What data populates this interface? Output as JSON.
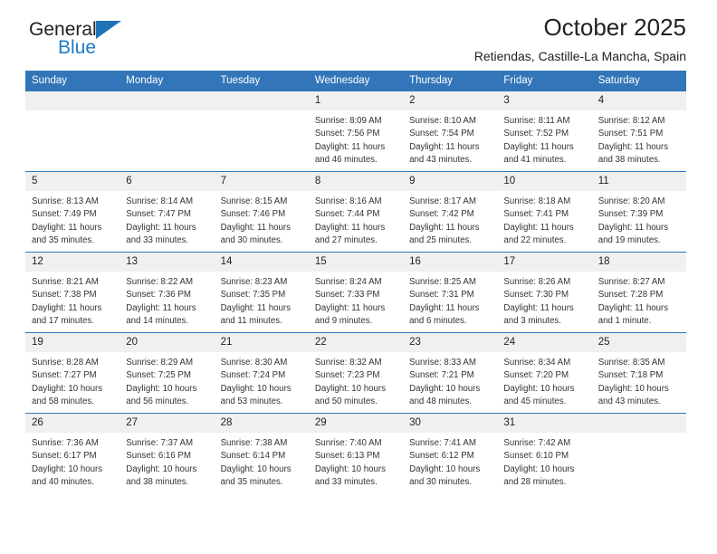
{
  "brand": {
    "name_top": "General",
    "name_bottom": "Blue",
    "triangle_color": "#1f72b8",
    "blue_color": "#1f7ac4"
  },
  "header": {
    "title": "October 2025",
    "subtitle": "Retiendas, Castille-La Mancha, Spain"
  },
  "colors": {
    "header_blue": "#3275b9",
    "daynum_band": "#f0f0f0",
    "text": "#222222"
  },
  "weekday_headers": [
    "Sunday",
    "Monday",
    "Tuesday",
    "Wednesday",
    "Thursday",
    "Friday",
    "Saturday"
  ],
  "labels": {
    "sunrise": "Sunrise:",
    "sunset": "Sunset:",
    "daylight": "Daylight:"
  },
  "weeks": [
    [
      {
        "day": "",
        "blank": true
      },
      {
        "day": "",
        "blank": true
      },
      {
        "day": "",
        "blank": true
      },
      {
        "day": "1",
        "sunrise": "Sunrise: 8:09 AM",
        "sunset": "Sunset: 7:56 PM",
        "daylight_1": "Daylight: 11 hours",
        "daylight_2": "and 46 minutes."
      },
      {
        "day": "2",
        "sunrise": "Sunrise: 8:10 AM",
        "sunset": "Sunset: 7:54 PM",
        "daylight_1": "Daylight: 11 hours",
        "daylight_2": "and 43 minutes."
      },
      {
        "day": "3",
        "sunrise": "Sunrise: 8:11 AM",
        "sunset": "Sunset: 7:52 PM",
        "daylight_1": "Daylight: 11 hours",
        "daylight_2": "and 41 minutes."
      },
      {
        "day": "4",
        "sunrise": "Sunrise: 8:12 AM",
        "sunset": "Sunset: 7:51 PM",
        "daylight_1": "Daylight: 11 hours",
        "daylight_2": "and 38 minutes."
      }
    ],
    [
      {
        "day": "5",
        "sunrise": "Sunrise: 8:13 AM",
        "sunset": "Sunset: 7:49 PM",
        "daylight_1": "Daylight: 11 hours",
        "daylight_2": "and 35 minutes."
      },
      {
        "day": "6",
        "sunrise": "Sunrise: 8:14 AM",
        "sunset": "Sunset: 7:47 PM",
        "daylight_1": "Daylight: 11 hours",
        "daylight_2": "and 33 minutes."
      },
      {
        "day": "7",
        "sunrise": "Sunrise: 8:15 AM",
        "sunset": "Sunset: 7:46 PM",
        "daylight_1": "Daylight: 11 hours",
        "daylight_2": "and 30 minutes."
      },
      {
        "day": "8",
        "sunrise": "Sunrise: 8:16 AM",
        "sunset": "Sunset: 7:44 PM",
        "daylight_1": "Daylight: 11 hours",
        "daylight_2": "and 27 minutes."
      },
      {
        "day": "9",
        "sunrise": "Sunrise: 8:17 AM",
        "sunset": "Sunset: 7:42 PM",
        "daylight_1": "Daylight: 11 hours",
        "daylight_2": "and 25 minutes."
      },
      {
        "day": "10",
        "sunrise": "Sunrise: 8:18 AM",
        "sunset": "Sunset: 7:41 PM",
        "daylight_1": "Daylight: 11 hours",
        "daylight_2": "and 22 minutes."
      },
      {
        "day": "11",
        "sunrise": "Sunrise: 8:20 AM",
        "sunset": "Sunset: 7:39 PM",
        "daylight_1": "Daylight: 11 hours",
        "daylight_2": "and 19 minutes."
      }
    ],
    [
      {
        "day": "12",
        "sunrise": "Sunrise: 8:21 AM",
        "sunset": "Sunset: 7:38 PM",
        "daylight_1": "Daylight: 11 hours",
        "daylight_2": "and 17 minutes."
      },
      {
        "day": "13",
        "sunrise": "Sunrise: 8:22 AM",
        "sunset": "Sunset: 7:36 PM",
        "daylight_1": "Daylight: 11 hours",
        "daylight_2": "and 14 minutes."
      },
      {
        "day": "14",
        "sunrise": "Sunrise: 8:23 AM",
        "sunset": "Sunset: 7:35 PM",
        "daylight_1": "Daylight: 11 hours",
        "daylight_2": "and 11 minutes."
      },
      {
        "day": "15",
        "sunrise": "Sunrise: 8:24 AM",
        "sunset": "Sunset: 7:33 PM",
        "daylight_1": "Daylight: 11 hours",
        "daylight_2": "and 9 minutes."
      },
      {
        "day": "16",
        "sunrise": "Sunrise: 8:25 AM",
        "sunset": "Sunset: 7:31 PM",
        "daylight_1": "Daylight: 11 hours",
        "daylight_2": "and 6 minutes."
      },
      {
        "day": "17",
        "sunrise": "Sunrise: 8:26 AM",
        "sunset": "Sunset: 7:30 PM",
        "daylight_1": "Daylight: 11 hours",
        "daylight_2": "and 3 minutes."
      },
      {
        "day": "18",
        "sunrise": "Sunrise: 8:27 AM",
        "sunset": "Sunset: 7:28 PM",
        "daylight_1": "Daylight: 11 hours",
        "daylight_2": "and 1 minute."
      }
    ],
    [
      {
        "day": "19",
        "sunrise": "Sunrise: 8:28 AM",
        "sunset": "Sunset: 7:27 PM",
        "daylight_1": "Daylight: 10 hours",
        "daylight_2": "and 58 minutes."
      },
      {
        "day": "20",
        "sunrise": "Sunrise: 8:29 AM",
        "sunset": "Sunset: 7:25 PM",
        "daylight_1": "Daylight: 10 hours",
        "daylight_2": "and 56 minutes."
      },
      {
        "day": "21",
        "sunrise": "Sunrise: 8:30 AM",
        "sunset": "Sunset: 7:24 PM",
        "daylight_1": "Daylight: 10 hours",
        "daylight_2": "and 53 minutes."
      },
      {
        "day": "22",
        "sunrise": "Sunrise: 8:32 AM",
        "sunset": "Sunset: 7:23 PM",
        "daylight_1": "Daylight: 10 hours",
        "daylight_2": "and 50 minutes."
      },
      {
        "day": "23",
        "sunrise": "Sunrise: 8:33 AM",
        "sunset": "Sunset: 7:21 PM",
        "daylight_1": "Daylight: 10 hours",
        "daylight_2": "and 48 minutes."
      },
      {
        "day": "24",
        "sunrise": "Sunrise: 8:34 AM",
        "sunset": "Sunset: 7:20 PM",
        "daylight_1": "Daylight: 10 hours",
        "daylight_2": "and 45 minutes."
      },
      {
        "day": "25",
        "sunrise": "Sunrise: 8:35 AM",
        "sunset": "Sunset: 7:18 PM",
        "daylight_1": "Daylight: 10 hours",
        "daylight_2": "and 43 minutes."
      }
    ],
    [
      {
        "day": "26",
        "sunrise": "Sunrise: 7:36 AM",
        "sunset": "Sunset: 6:17 PM",
        "daylight_1": "Daylight: 10 hours",
        "daylight_2": "and 40 minutes."
      },
      {
        "day": "27",
        "sunrise": "Sunrise: 7:37 AM",
        "sunset": "Sunset: 6:16 PM",
        "daylight_1": "Daylight: 10 hours",
        "daylight_2": "and 38 minutes."
      },
      {
        "day": "28",
        "sunrise": "Sunrise: 7:38 AM",
        "sunset": "Sunset: 6:14 PM",
        "daylight_1": "Daylight: 10 hours",
        "daylight_2": "and 35 minutes."
      },
      {
        "day": "29",
        "sunrise": "Sunrise: 7:40 AM",
        "sunset": "Sunset: 6:13 PM",
        "daylight_1": "Daylight: 10 hours",
        "daylight_2": "and 33 minutes."
      },
      {
        "day": "30",
        "sunrise": "Sunrise: 7:41 AM",
        "sunset": "Sunset: 6:12 PM",
        "daylight_1": "Daylight: 10 hours",
        "daylight_2": "and 30 minutes."
      },
      {
        "day": "31",
        "sunrise": "Sunrise: 7:42 AM",
        "sunset": "Sunset: 6:10 PM",
        "daylight_1": "Daylight: 10 hours",
        "daylight_2": "and 28 minutes."
      },
      {
        "day": "",
        "blank": true
      }
    ]
  ]
}
